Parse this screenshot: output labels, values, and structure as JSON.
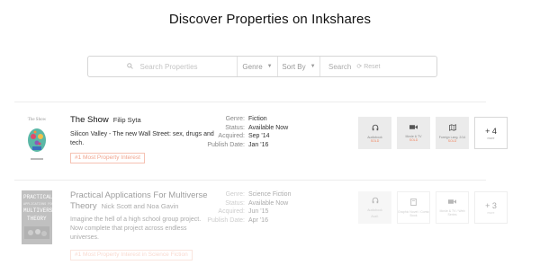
{
  "header": {
    "title": "Discover Properties on Inkshares"
  },
  "search": {
    "placeholder": "Search Properties",
    "genre_label": "Genre",
    "sort_label": "Sort By",
    "search_label": "Search",
    "reset_label": "Reset"
  },
  "meta_labels": {
    "genre": "Genre:",
    "status": "Status:",
    "acquired": "Acquired:",
    "publish_date": "Publish Date:"
  },
  "properties": [
    {
      "cover_title": "The Show",
      "title": "The Show",
      "authors": "Filip Syta",
      "description": "Silicon Valley - The new Wall Street: sex, drugs and tech.",
      "badge": "#1 Most Property Interest",
      "genre": "Fiction",
      "status": "Available Now",
      "acquired": "Sep '14",
      "publish_date": "Jan '16",
      "tiles": [
        {
          "icon": "headphones-icon",
          "label": "Audiobook",
          "sub": "SOLD"
        },
        {
          "icon": "video-camera-icon",
          "label": "Movie & TV",
          "sub": "SOLD"
        },
        {
          "icon": "map-icon",
          "label": "Foreign Lang. 2/14",
          "sub": "SOLD"
        }
      ],
      "more": {
        "count": "+ 4",
        "label": "more"
      }
    },
    {
      "cover_title": "PRACTICAL APPLICATIONS FOR MULTIVERSE THEORY",
      "title": "Practical Applications For Multiverse Theory",
      "authors": "Nick Scott and Noa Gavin",
      "description": "Imagine the hell of a high school group project. Now complete that project across endless universes.",
      "badge": "#1 Most Property Interest in Science Fiction",
      "genre": "Science Fiction",
      "status": "Available Now",
      "acquired": "Jun '15",
      "publish_date": "Apr '16",
      "tiles": [
        {
          "icon": "headphones-icon",
          "label": "Audiobook",
          "sub": "Avail."
        },
        {
          "icon": "book-icon",
          "label": "Graphic Novel / Comic Book",
          "sub": ""
        },
        {
          "icon": "video-camera-icon",
          "label": "Movie & TV / Web Series",
          "sub": ""
        }
      ],
      "more": {
        "count": "+ 3",
        "label": "more"
      }
    }
  ]
}
